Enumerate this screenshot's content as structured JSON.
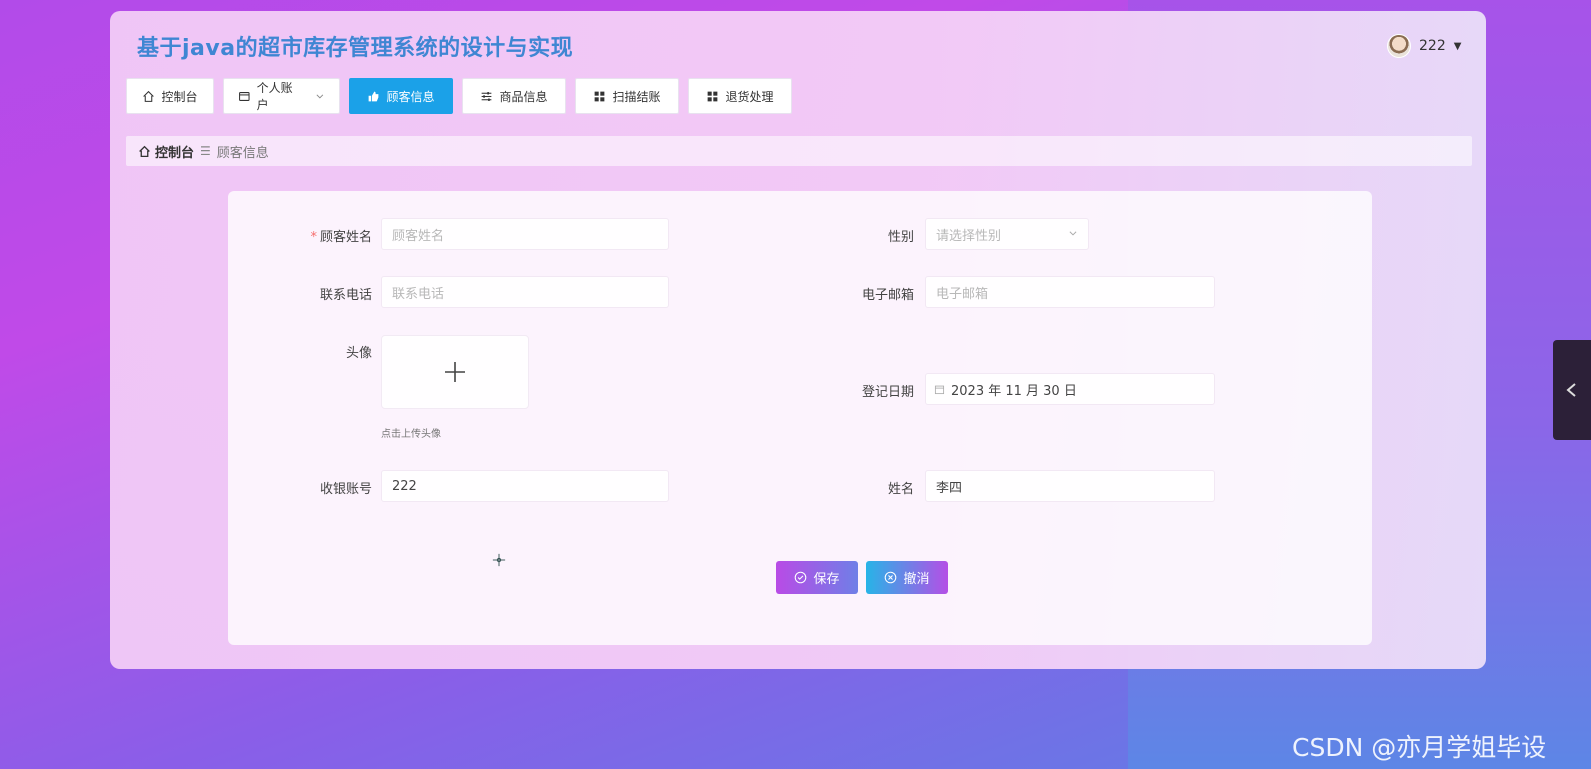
{
  "app": {
    "title": "基于java的超市库存管理系统的设计与实现",
    "username": "222"
  },
  "nav": {
    "items": [
      {
        "label": "控制台",
        "icon": "home-icon"
      },
      {
        "label": "个人账户",
        "icon": "credit-card-icon",
        "dropdown": true
      },
      {
        "label": "顾客信息",
        "icon": "thumb-icon",
        "active": true
      },
      {
        "label": "商品信息",
        "icon": "sliders-icon"
      },
      {
        "label": "扫描结账",
        "icon": "grid-icon"
      },
      {
        "label": "退货处理",
        "icon": "grid-icon"
      }
    ]
  },
  "breadcrumb": {
    "home": "控制台",
    "separator": "☰",
    "current": "顾客信息"
  },
  "form": {
    "customer_name": {
      "label": "顾客姓名",
      "placeholder": "顾客姓名",
      "required": true
    },
    "gender": {
      "label": "性别",
      "placeholder": "请选择性别"
    },
    "phone": {
      "label": "联系电话",
      "placeholder": "联系电话"
    },
    "email": {
      "label": "电子邮箱",
      "placeholder": "电子邮箱"
    },
    "avatar": {
      "label": "头像",
      "tip": "点击上传头像"
    },
    "register_date": {
      "label": "登记日期",
      "value": "2023 年 11 月 30 日"
    },
    "cashier_account": {
      "label": "收银账号",
      "value": "222"
    },
    "name": {
      "label": "姓名",
      "value": "李四"
    },
    "save_label": "保存",
    "cancel_label": "撤消"
  },
  "watermark": "CSDN @亦月学姐毕设",
  "colors": {
    "accent": "#1ba1e8",
    "title": "#3f86d3",
    "required": "#f56c6c"
  }
}
